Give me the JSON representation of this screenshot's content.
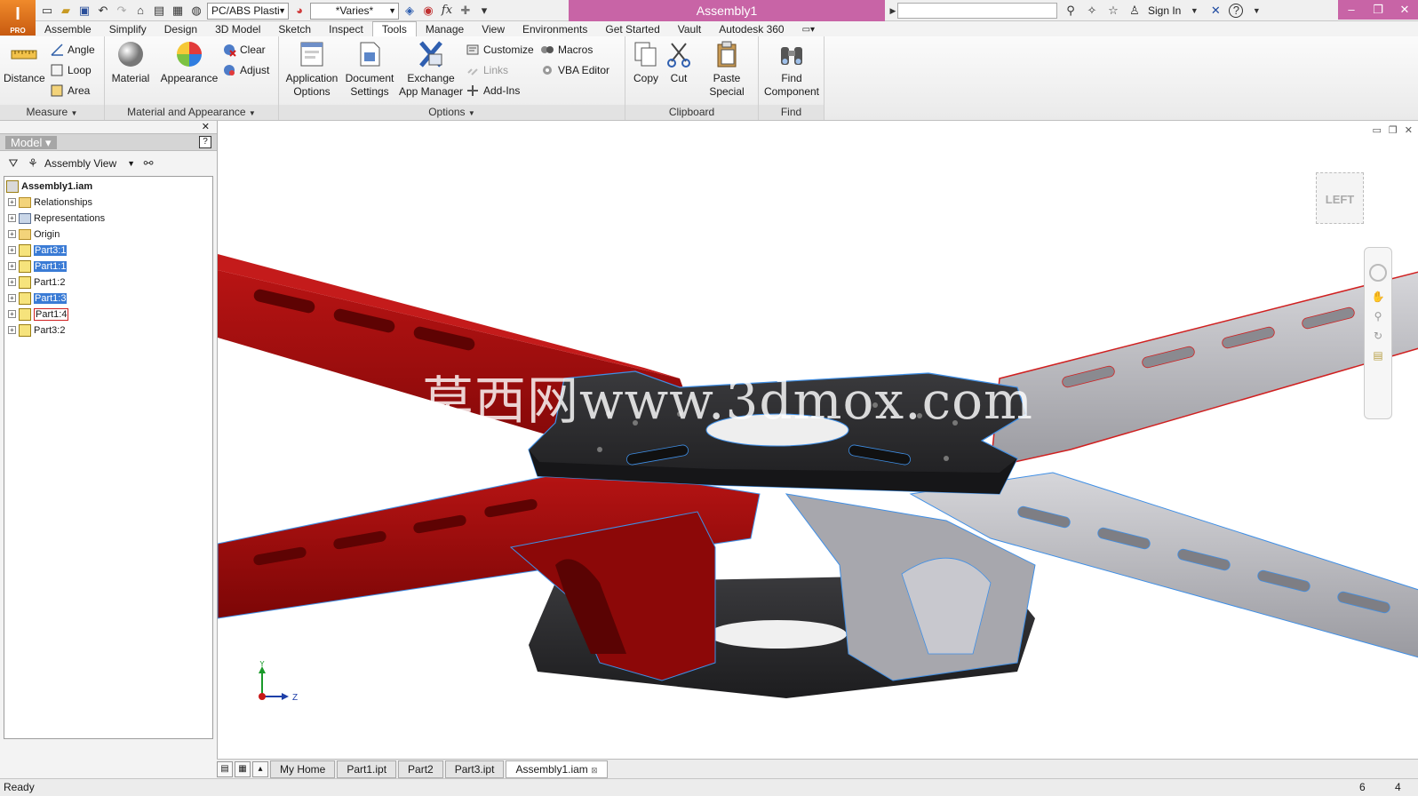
{
  "app": {
    "logo_letter": "I",
    "logo_badge": "PRO",
    "document_title": "Assembly1"
  },
  "quick_access": {
    "material_combo": "PC/ABS Plasti",
    "appearance_combo": "*Varies*",
    "fx": "fx",
    "search_placeholder": "",
    "sign_in": "Sign In"
  },
  "ribbon_tabs": [
    "Assemble",
    "Simplify",
    "Design",
    "3D Model",
    "Sketch",
    "Inspect",
    "Tools",
    "Manage",
    "View",
    "Environments",
    "Get Started",
    "Vault",
    "Autodesk 360"
  ],
  "active_tab": "Tools",
  "panels": {
    "measure": {
      "title": "Measure",
      "distance": "Distance",
      "angle": "Angle",
      "loop": "Loop",
      "area": "Area"
    },
    "material": {
      "title": "Material and Appearance",
      "material": "Material",
      "appearance": "Appearance",
      "clear": "Clear",
      "adjust": "Adjust"
    },
    "options": {
      "title": "Options",
      "app_options_1": "Application",
      "app_options_2": "Options",
      "doc_settings_1": "Document",
      "doc_settings_2": "Settings",
      "exchange_1": "Exchange",
      "exchange_2": "App Manager",
      "customize": "Customize",
      "links": "Links",
      "addins": "Add-Ins",
      "macros": "Macros",
      "vba": "VBA Editor"
    },
    "clipboard": {
      "title": "Clipboard",
      "copy": "Copy",
      "cut": "Cut",
      "paste_1": "Paste",
      "paste_2": "Special"
    },
    "find": {
      "title": "Find",
      "find_1": "Find",
      "find_2": "Component"
    }
  },
  "browser": {
    "title": "Model",
    "view_mode": "Assembly View",
    "root": "Assembly1.iam",
    "items": [
      {
        "label": "Relationships",
        "kind": "folder",
        "state": "normal"
      },
      {
        "label": "Representations",
        "kind": "folder",
        "state": "normal"
      },
      {
        "label": "Origin",
        "kind": "folder",
        "state": "normal"
      },
      {
        "label": "Part3:1",
        "kind": "part",
        "state": "selected"
      },
      {
        "label": "Part1:1",
        "kind": "part",
        "state": "selected"
      },
      {
        "label": "Part1:2",
        "kind": "part",
        "state": "normal"
      },
      {
        "label": "Part1:3",
        "kind": "part",
        "state": "selected"
      },
      {
        "label": "Part1:4",
        "kind": "part",
        "state": "highlighted"
      },
      {
        "label": "Part3:2",
        "kind": "part",
        "state": "normal"
      }
    ]
  },
  "viewport": {
    "watermark": "莫西网www.3dmox.com",
    "viewcube_face": "LEFT",
    "axis_y": "Y",
    "axis_z": "Z",
    "colors": {
      "red_arm": "#9e0a0a",
      "gray_arm": "#b8b8bc",
      "carbon_plate": "#2c2c2e",
      "edge_highlight": "#3f8fe6"
    }
  },
  "doc_tabs": [
    "My Home",
    "Part1.ipt",
    "Part2",
    "Part3.ipt",
    "Assembly1.iam"
  ],
  "active_doc": "Assembly1.iam",
  "status": {
    "text": "Ready",
    "count_a": "6",
    "count_b": "4"
  }
}
